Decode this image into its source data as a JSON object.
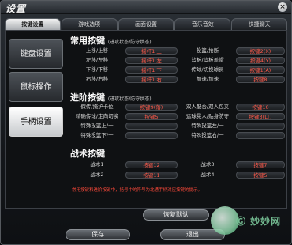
{
  "window": {
    "title": "设置",
    "close_glyph": "×"
  },
  "tabs": [
    "按键设置",
    "游戏选项",
    "画面设置",
    "音乐音效",
    "快捷聊天"
  ],
  "sidebar": [
    "键盘设置",
    "鼠标操作",
    "手柄设置"
  ],
  "common": {
    "title": "常用按键",
    "subtitle": "(进攻状态/防守状态)",
    "rows": [
      [
        "上移/上移",
        "摇杆1 上",
        "投篮/抢断",
        "按键2(X)"
      ],
      [
        "左移/左移",
        "摇杆1 左",
        "篮板/篮板盖帽",
        "按键4(Y)"
      ],
      [
        "下移/下移",
        "摇杆1 下",
        "传球/切换球员",
        "按键1(A)"
      ],
      [
        "右移/右移",
        "摇杆1 右",
        "加速/加速",
        "按键8"
      ]
    ]
  },
  "advanced": {
    "title": "进阶按键",
    "subtitle": "(进攻状态/防守状态)",
    "rows": [
      [
        "假传/掩护卡位",
        "按键9(落)",
        "双人配合/双人包夹",
        "按键10"
      ],
      [
        "精确传球/定向切换",
        "按键5",
        "运球晃人/贴身防守",
        "按键3(LT)"
      ],
      [
        "特殊投篮上/一",
        "",
        "特殊投篮左/一",
        ""
      ],
      [
        "特殊投篮下/一",
        "",
        "特殊投篮右/一",
        ""
      ]
    ]
  },
  "tactics": {
    "title": "战术按键",
    "rows": [
      [
        "战术1",
        "按键12",
        "战术3",
        "按键7"
      ],
      [
        "战术2",
        "按键11",
        "战术4",
        "按键5"
      ]
    ]
  },
  "note": "常用按键和进阶按键中，括号中的符号为北通手柄对应按键的提示。",
  "buttons": {
    "restore": "恢复默认",
    "save": "保存",
    "exit": "退出"
  },
  "watermark": "Ⓖ 妙妙网"
}
